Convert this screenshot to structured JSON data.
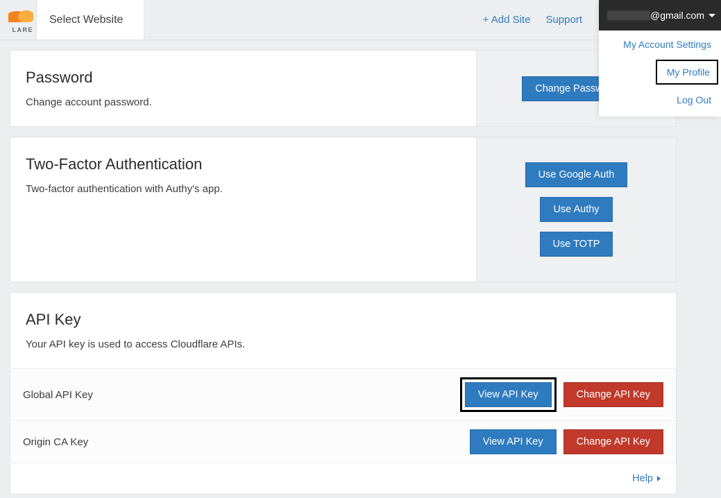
{
  "topbar": {
    "logo_text": "LARE",
    "select_site": "Select Website",
    "add_site": "+ Add Site",
    "support": "Support"
  },
  "account": {
    "email_suffix": "@gmail.com",
    "settings": "My Account Settings",
    "profile": "My Profile",
    "logout": "Log Out"
  },
  "password_panel": {
    "title": "Password",
    "desc": "Change account password.",
    "button": "Change Password"
  },
  "twofa_panel": {
    "title": "Two-Factor Authentication",
    "desc": "Two-factor authentication with Authy's app.",
    "google": "Use Google Auth",
    "authy": "Use Authy",
    "totp": "Use TOTP"
  },
  "api_panel": {
    "title": "API Key",
    "desc": "Your API key is used to access Cloudflare APIs.",
    "rows": [
      {
        "label": "Global API Key",
        "view": "View API Key",
        "change": "Change API Key"
      },
      {
        "label": "Origin CA Key",
        "view": "View API Key",
        "change": "Change API Key"
      }
    ],
    "help": "Help"
  }
}
